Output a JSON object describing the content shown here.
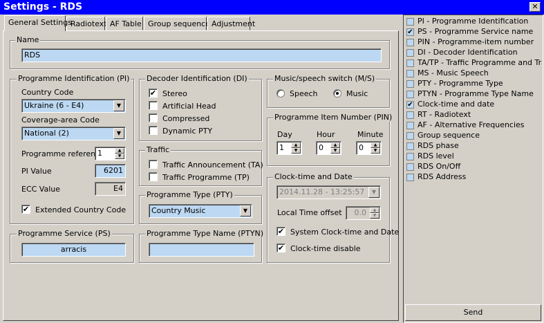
{
  "window": {
    "title": "Settings - RDS",
    "close": "✕"
  },
  "tabs": [
    "General Settings",
    "Radiotext",
    "AF Table",
    "Group sequence",
    "Adjustment"
  ],
  "name_group": {
    "legend": "Name",
    "value": "RDS"
  },
  "pi_group": {
    "legend": "Programme Identification (PI)",
    "country_label": "Country Code",
    "country_value": "Ukraine (6 - E4)",
    "area_label": "Coverage-area Code",
    "area_value": "National (2)",
    "ref_label": "Programme reference",
    "ref_value": "1",
    "pi_label": "PI Value",
    "pi_value": "6201",
    "ecc_label": "ECC Value",
    "ecc_value": "E4",
    "extended_label": "Extended Country Code",
    "extended_checked": true
  },
  "ps_group": {
    "legend": "Programme Service (PS)",
    "value": "arracis"
  },
  "di_group": {
    "legend": "Decoder Identification (DI)",
    "items": [
      {
        "label": "Stereo",
        "checked": true
      },
      {
        "label": "Artificial Head",
        "checked": false
      },
      {
        "label": "Compressed",
        "checked": false
      },
      {
        "label": "Dynamic PTY",
        "checked": false
      }
    ]
  },
  "traffic_group": {
    "legend": "Traffic",
    "items": [
      {
        "label": "Traffic Announcement (TA)",
        "checked": false
      },
      {
        "label": "Traffic Programme (TP)",
        "checked": false
      }
    ]
  },
  "pty_group": {
    "legend": "Programme Type (PTY)",
    "value": "Country Music"
  },
  "ptyn_group": {
    "legend": "Programme Type Name (PTYN)",
    "value": ""
  },
  "ms_group": {
    "legend": "Music/speech switch (M/S)",
    "speech": "Speech",
    "music": "Music",
    "selected": "Music"
  },
  "pin_group": {
    "legend": "Programme Item Number (PIN)",
    "day_label": "Day",
    "day_value": "1",
    "hour_label": "Hour",
    "hour_value": "0",
    "minute_label": "Minute",
    "minute_value": "0"
  },
  "ct_group": {
    "legend": "Clock-time and Date",
    "datetime_value": "2014.11.28 - 13:25:57",
    "offset_label": "Local Time offset",
    "offset_value": "0.0",
    "system_label": "System Clock-time and Date",
    "system_checked": true,
    "disable_label": "Clock-time disable",
    "disable_checked": true
  },
  "sidebar": {
    "items": [
      {
        "label": "PI - Programme Identification",
        "checked": false
      },
      {
        "label": "PS - Programme Service name",
        "checked": true
      },
      {
        "label": "PIN - Programme-item number",
        "checked": false
      },
      {
        "label": "DI - Decoder Identification",
        "checked": false
      },
      {
        "label": "TA/TP - Traffic Programme and Traffic",
        "checked": false
      },
      {
        "label": "MS - Music Speech",
        "checked": false
      },
      {
        "label": "PTY - Programme Type",
        "checked": false
      },
      {
        "label": "PTYN - Programme Type Name",
        "checked": false
      },
      {
        "label": "Clock-time and date",
        "checked": true
      },
      {
        "label": "RT - Radiotext",
        "checked": false
      },
      {
        "label": "AF - Alternative Frequencies",
        "checked": false
      },
      {
        "label": "Group sequence",
        "checked": false
      },
      {
        "label": "RDS phase",
        "checked": false
      },
      {
        "label": "RDS level",
        "checked": false
      },
      {
        "label": "RDS On/Off",
        "checked": false
      },
      {
        "label": "RDS Address",
        "checked": false
      }
    ],
    "send_label": "Send"
  },
  "icons": {
    "check": "✔",
    "dropdown": "▼",
    "spin_up": "▲",
    "spin_down": "▼"
  },
  "colors": {
    "title_bar": "#0000ff",
    "field_bg": "#bcd8f2",
    "face": "#d4d0c8"
  }
}
